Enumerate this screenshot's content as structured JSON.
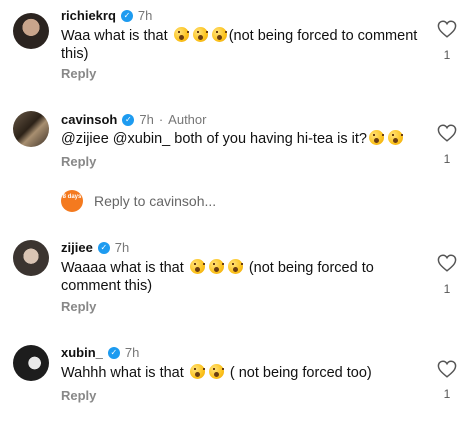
{
  "comments": [
    {
      "username": "richiekrq",
      "time": "7h",
      "author_tag": "",
      "text_before": "Waa what is that",
      "text_after": "(not being forced to comment this)",
      "reply_label": "Reply",
      "likes": "1"
    },
    {
      "username": "cavinsoh",
      "time": "7h",
      "author_tag": "Author",
      "text_before": "@zijiee @xubin_ both of you having hi-tea is it?",
      "text_after": "",
      "reply_label": "Reply",
      "likes": "1"
    },
    {
      "username": "zijiee",
      "time": "7h",
      "author_tag": "",
      "text_before": "Waaaa what is that",
      "text_after": "(not being forced to comment this)",
      "reply_label": "Reply",
      "likes": "1"
    },
    {
      "username": "xubin_",
      "time": "7h",
      "author_tag": "",
      "text_before": "Wahhh what is that",
      "text_after": "( not being forced too)",
      "reply_label": "Reply",
      "likes": "1"
    }
  ],
  "reply_input": {
    "placeholder": "Reply to cavinsoh...",
    "avatar_text": "8 days"
  },
  "colors": {
    "verified": "#1d9bf0",
    "reply_avatar": "#f47a1f"
  },
  "icons": {
    "like": "heart-outline-icon",
    "verified": "verified-badge-icon",
    "emoji": "astonished-face-emoji"
  }
}
